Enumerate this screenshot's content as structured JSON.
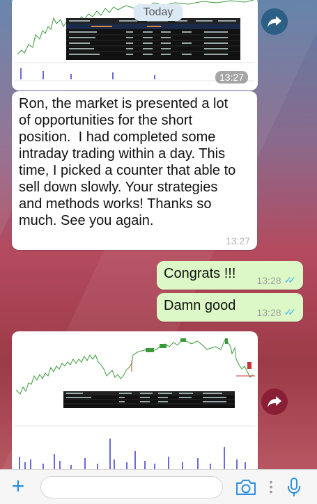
{
  "chat": {
    "date_chip": "Today",
    "messages": [
      {
        "kind": "image",
        "direction": "incoming",
        "time": "13:27"
      },
      {
        "kind": "text",
        "direction": "incoming",
        "text": "Ron, the market is presented a lot\nof opportunities for the short\nposition.  I had completed some\nintraday trading within a day. This\ntime, I picked a counter that able to\nsell down slowly. Your strategies\nand methods works! Thanks so\nmuch. See you again.",
        "time": "13:27"
      },
      {
        "kind": "text",
        "direction": "outgoing",
        "text": "Congrats !!!",
        "time": "13:28",
        "status": "read"
      },
      {
        "kind": "text",
        "direction": "outgoing",
        "text": "Damn good",
        "time": "13:28",
        "status": "read"
      },
      {
        "kind": "image",
        "direction": "incoming"
      }
    ]
  },
  "input_bar": {
    "placeholder": "",
    "value": "",
    "icons": [
      "plus-icon",
      "camera-icon",
      "more-dots-icon",
      "microphone-icon"
    ]
  },
  "colors": {
    "outgoing_bubble": "#dcf8c6",
    "incoming_bubble": "#ffffff",
    "read_ticks": "#4fb6ec",
    "accent": "#2f8fe0"
  }
}
